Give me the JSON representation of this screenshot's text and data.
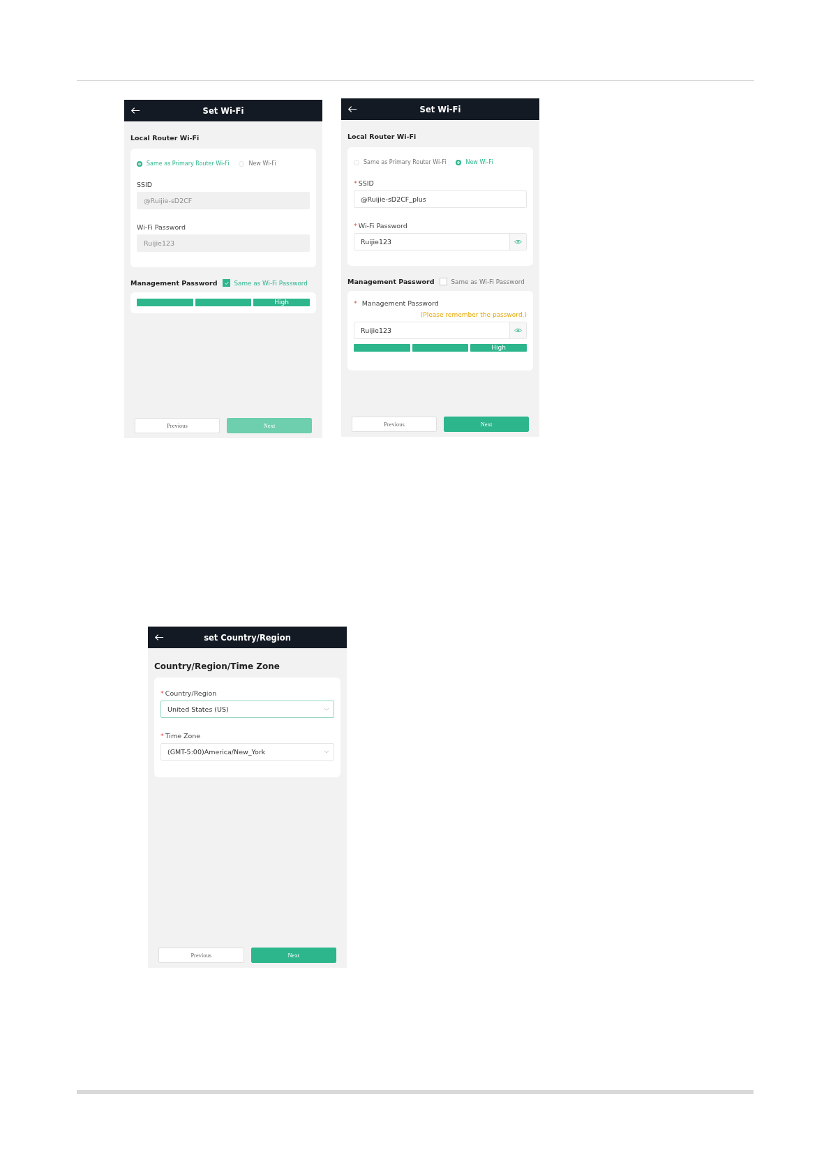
{
  "screens": [
    {
      "kind": "wifi",
      "title": "Set Wi-Fi",
      "section": "Local Router Wi-Fi",
      "options": [
        {
          "label": "Same as Primary Router Wi-Fi",
          "selected": true
        },
        {
          "label": "New Wi-Fi",
          "selected": false
        }
      ],
      "fields": [
        {
          "label": "SSID",
          "value": "@Ruijie-sD2CF",
          "disabled": true,
          "reveal": false
        },
        {
          "label": "Wi-Fi Password",
          "value": "Ruijie123",
          "disabled": true,
          "reveal": false
        }
      ],
      "management": {
        "label": "Management Password",
        "same_label": "Same as Wi-Fi Password",
        "checked": true,
        "strength": {
          "label": "High"
        }
      },
      "buttons": [
        {
          "label": "Previous",
          "kind": "secondary"
        },
        {
          "label": "Next",
          "kind": "primary",
          "disabled": true
        }
      ]
    },
    {
      "kind": "wifi",
      "title": "Set Wi-Fi",
      "section": "Local Router Wi-Fi",
      "options": [
        {
          "label": "Same as Primary Router Wi-Fi",
          "selected": false
        },
        {
          "label": "New Wi-Fi",
          "selected": true
        }
      ],
      "fields": [
        {
          "asterisk": "*",
          "label": "SSID",
          "value": "@Ruijie-sD2CF_plus",
          "disabled": false,
          "reveal": false
        },
        {
          "asterisk": "*",
          "label": "Wi-Fi Password",
          "value": "Ruijie123",
          "disabled": false,
          "reveal": true
        }
      ],
      "management": {
        "label": "Management Password",
        "same_label": "Same as Wi-Fi Password",
        "checked": false,
        "fields": [
          {
            "asterisk": "*",
            "label": "Management Password",
            "hint": "(Please remember the password.)",
            "value": "Ruijie123",
            "disabled": false,
            "reveal": true
          }
        ],
        "strength": {
          "label": "High"
        }
      },
      "buttons": [
        {
          "label": "Previous",
          "kind": "secondary"
        },
        {
          "label": "Next",
          "kind": "primary",
          "disabled": false
        }
      ]
    },
    {
      "kind": "region",
      "title": "set Country/Region",
      "section": "Country/Region/Time Zone",
      "selects": [
        {
          "asterisk": "*",
          "label": "Country/Region",
          "value": "United States (US)",
          "focused": true
        },
        {
          "asterisk": "*",
          "label": "Time Zone",
          "value": "(GMT-5:00)America/New_York",
          "focused": false
        }
      ],
      "buttons": [
        {
          "label": "Previous",
          "kind": "secondary"
        },
        {
          "label": "Next",
          "kind": "primary",
          "disabled": false
        }
      ]
    }
  ]
}
